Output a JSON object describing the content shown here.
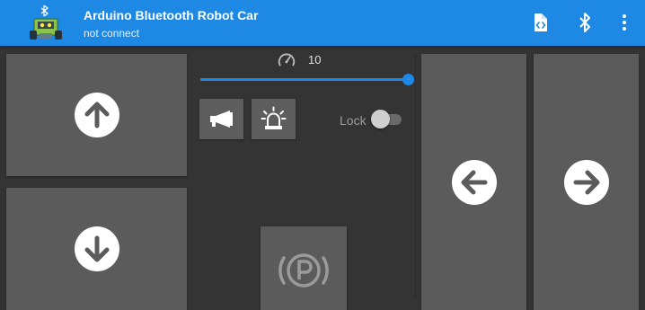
{
  "app": {
    "title": "Arduino Bluetooth Robot Car",
    "status": "not connect"
  },
  "toolbar": {
    "icons": [
      "file-code-icon",
      "bluetooth-icon",
      "more-vert-icon"
    ]
  },
  "controls": {
    "forward_icon": "arrow-up-icon",
    "backward_icon": "arrow-down-icon",
    "left_icon": "arrow-left-icon",
    "right_icon": "arrow-right-icon",
    "horn_icon": "horn-icon",
    "siren_icon": "siren-light-icon",
    "park_icon": "parking-brake-icon"
  },
  "speed": {
    "icon": "speedometer-icon",
    "value": "10",
    "fill_fraction": 1.0
  },
  "lock": {
    "label": "Lock",
    "on": false
  },
  "colors": {
    "primary": "#1e88e5",
    "background": "#343434",
    "pad": "#5b5b5b"
  }
}
